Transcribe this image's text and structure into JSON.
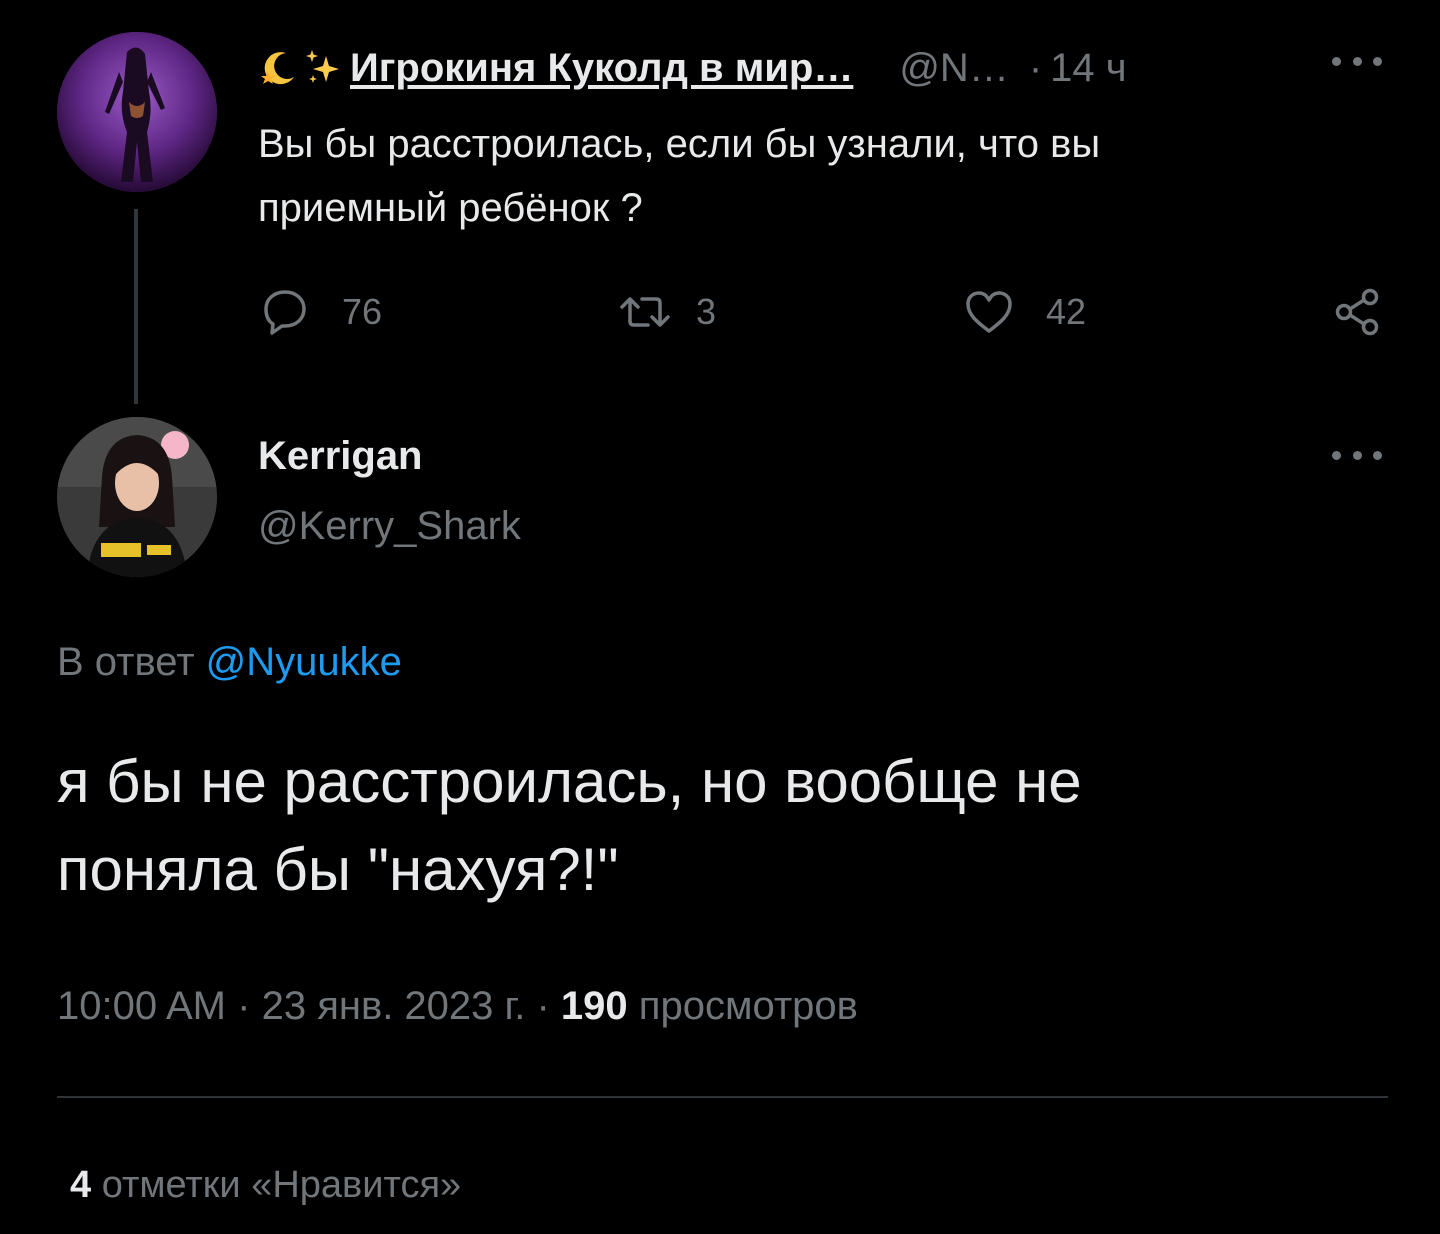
{
  "parent_tweet": {
    "display_name": "Игрокиня Куколд в мир…",
    "handle": "@N…",
    "separator": "·",
    "time": "14 ч",
    "text_line1": "Вы бы расстроилась, если бы узнали, что вы",
    "text_line2": "приемный ребёнок ?",
    "replies": "76",
    "retweets": "3",
    "likes": "42"
  },
  "reply_tweet": {
    "display_name": "Kerrigan",
    "handle": "@Kerry_Shark",
    "reply_prefix": "В ответ",
    "reply_mention": "@Nyuukke",
    "text_line1": "я бы не расстроилась, но вообще не",
    "text_line2": "поняла бы \"нахуя?!\"",
    "time": "10:00 AM",
    "sep1": "·",
    "date": "23 янв. 2023 г.",
    "sep2": "·",
    "views_count": "190",
    "views_label": "просмотров",
    "likes_count": "4",
    "likes_label": "отметки «Нравится»"
  },
  "icons": {
    "more": "more-dots-icon",
    "reply": "reply-bubble-icon",
    "retweet": "retweet-icon",
    "like": "heart-icon",
    "share": "share-icon"
  },
  "colors": {
    "background": "#000000",
    "text_primary": "#e7e9ea",
    "text_secondary": "#71767b",
    "link": "#1d9bf0",
    "divider": "#2f3336"
  }
}
